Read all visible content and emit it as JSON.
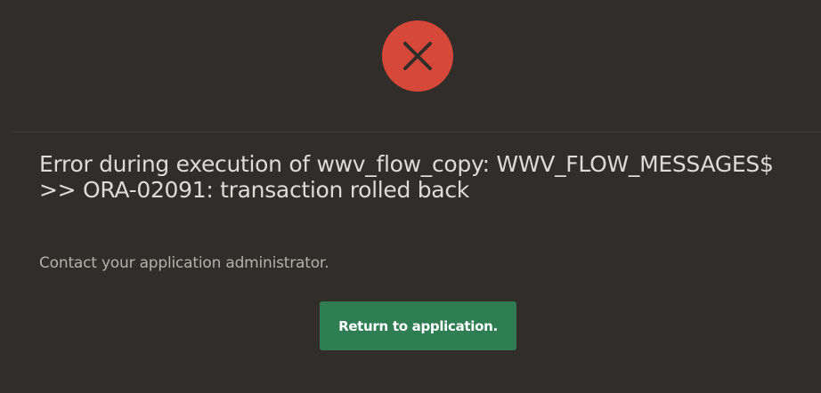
{
  "error": {
    "icon": "close-icon",
    "title": "Error during execution of wwv_flow_copy: WWV_FLOW_MESSAGES$ >> ORA-02091: transaction rolled back",
    "message": "Contact your application administrator."
  },
  "actions": {
    "return_label": "Return to application."
  },
  "colors": {
    "background": "#312d2a",
    "error_circle": "#d5483a",
    "icon_x": "#312d2a",
    "button": "#2f7d52",
    "title_text": "#dcdbd8",
    "message_text": "#b4b1ad"
  }
}
